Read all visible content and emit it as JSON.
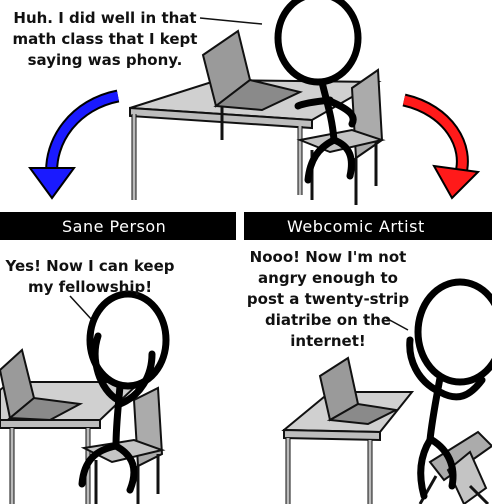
{
  "panel_top": {
    "caption_lines": [
      "Huh. I did well in that",
      "math class that I kept",
      "saying was phony."
    ]
  },
  "branches": {
    "left_label": "Sane Person",
    "right_label": "Webcomic Artist",
    "left_arrow_color": "#1a1aff",
    "right_arrow_color": "#ff1a1a",
    "divider_color": "#000000"
  },
  "panel_left": {
    "caption_lines": [
      "Yes! Now I can keep",
      "my fellowship!"
    ]
  },
  "panel_right": {
    "caption_lines": [
      "Nooo! Now I'm not",
      "angry enough to",
      "post a twenty-strip",
      "diatribe on the",
      "internet!"
    ]
  },
  "palette": {
    "table_top": "#cfcfcf",
    "table_legs": "#bfbfbf",
    "laptop": "#9a9a9a",
    "chair": "#aaaaaa"
  }
}
